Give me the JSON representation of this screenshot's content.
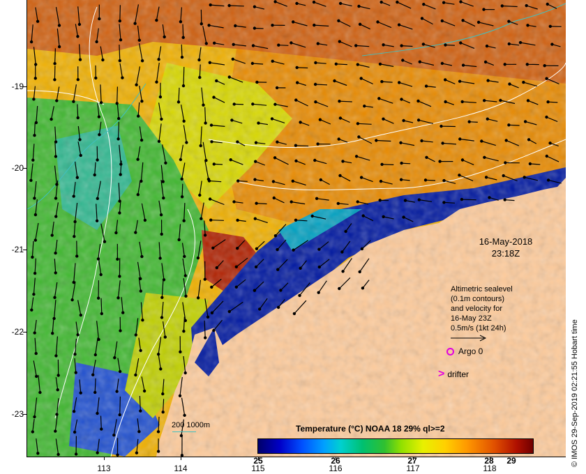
{
  "map": {
    "lat_labels": [
      "-19",
      "-20",
      "-21",
      "-22",
      "-23"
    ],
    "lon_labels": [
      "113",
      "114",
      "115",
      "116",
      "117",
      "118"
    ],
    "datetime_line1": "16-May-2018",
    "datetime_line2": "23:18Z",
    "altimetry_lines": [
      "Altimetric sealevel",
      "(0.1m contours)",
      "and velocity for",
      "16-May 23Z",
      "0.5m/s (1kt 24h)"
    ],
    "argo_label": "Argo 0",
    "drifter_label": "drifter",
    "colorbar_title": "Temperature (°C) NOAA 18 29% ql>=2",
    "colorbar_ticks": [
      "25",
      "26",
      "27",
      "28",
      "29"
    ],
    "depth_legend": "200  1000m",
    "credit": "© IMOS 29-Sep-2019 02:21:55 Hobart time",
    "colors": {
      "land": "#fecb9b",
      "marker": "#e000e0",
      "contour": "#ffffff",
      "depth_contour": "#40c0c0"
    }
  }
}
